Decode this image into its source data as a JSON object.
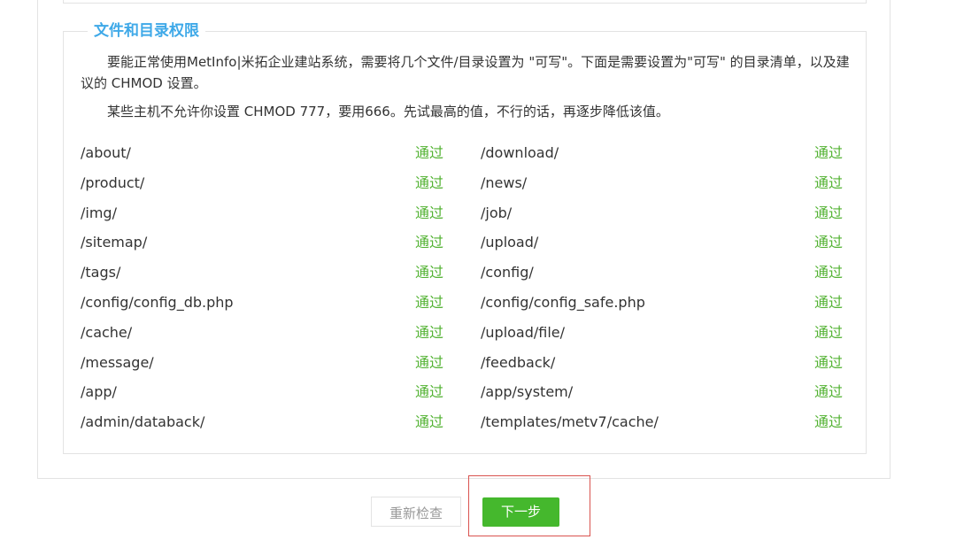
{
  "section": {
    "title": "文件和目录权限",
    "description_1": "要能正常使用MetInfo|米拓企业建站系统，需要将几个文件/目录设置为 \"可写\"。下面是需要设置为\"可写\" 的目录清单，以及建议的 CHMOD 设置。",
    "description_2": "某些主机不允许你设置 CHMOD 777，要用666。先试最高的值，不行的话，再逐步降低该值。"
  },
  "permissions": [
    {
      "left_path": "/about/",
      "left_status": "通过",
      "right_path": "/download/",
      "right_status": "通过"
    },
    {
      "left_path": "/product/",
      "left_status": "通过",
      "right_path": "/news/",
      "right_status": "通过"
    },
    {
      "left_path": "/img/",
      "left_status": "通过",
      "right_path": "/job/",
      "right_status": "通过"
    },
    {
      "left_path": "/sitemap/",
      "left_status": "通过",
      "right_path": "/upload/",
      "right_status": "通过"
    },
    {
      "left_path": "/tags/",
      "left_status": "通过",
      "right_path": "/config/",
      "right_status": "通过"
    },
    {
      "left_path": "/config/config_db.php",
      "left_status": "通过",
      "right_path": "/config/config_safe.php",
      "right_status": "通过"
    },
    {
      "left_path": "/cache/",
      "left_status": "通过",
      "right_path": "/upload/file/",
      "right_status": "通过"
    },
    {
      "left_path": "/message/",
      "left_status": "通过",
      "right_path": "/feedback/",
      "right_status": "通过"
    },
    {
      "left_path": "/app/",
      "left_status": "通过",
      "right_path": "/app/system/",
      "right_status": "通过"
    },
    {
      "left_path": "/admin/databack/",
      "left_status": "通过",
      "right_path": "/templates/metv7/cache/",
      "right_status": "通过"
    }
  ],
  "buttons": {
    "recheck": "重新检查",
    "next": "下一步"
  },
  "colors": {
    "title": "#3fa9e8",
    "pass": "#52b232",
    "next_button": "#45b82d",
    "highlight": "#d9534f"
  }
}
